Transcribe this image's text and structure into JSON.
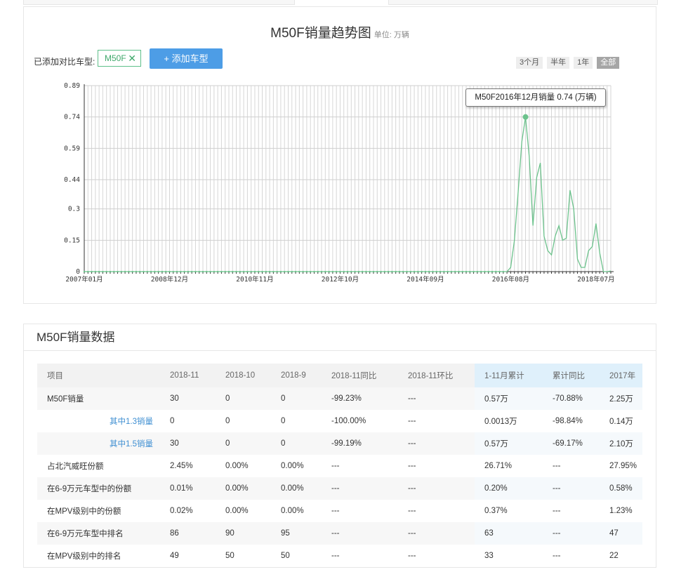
{
  "chart_section": {
    "title": "M50F销量趋势图",
    "unit": "单位: 万辆",
    "compare_label": "已添加对比车型:",
    "model_tag": "M50F",
    "remove_icon": "✕",
    "add_button": "+ 添加车型",
    "range_buttons": [
      "3个月",
      "半年",
      "1年",
      "全部"
    ],
    "active_range": "全部",
    "tooltip": "M50F2016年12月销量 0.74 (万辆)"
  },
  "chart_data": {
    "type": "line",
    "title": "M50F销量趋势图",
    "unit": "单位: 万辆",
    "ylim": [
      0,
      0.89
    ],
    "y_ticks": [
      "0",
      "0.15",
      "0.3",
      "0.44",
      "0.59",
      "0.74",
      "0.89"
    ],
    "x_ticks": [
      "2007年01月",
      "2008年12月",
      "2010年11月",
      "2012年10月",
      "2014年09月",
      "2016年08月",
      "2018年07月"
    ],
    "x_range": [
      "2007-01",
      "2018-11"
    ],
    "grid": "vertical monthly lines and horizontal lines at y ticks",
    "series": [
      {
        "name": "M50F",
        "color": "#6cc28c",
        "x": [
          "2016-07",
          "2016-08",
          "2016-09",
          "2016-10",
          "2016-11",
          "2016-12",
          "2017-01",
          "2017-02",
          "2017-03",
          "2017-04",
          "2017-05",
          "2017-06",
          "2017-07",
          "2017-08",
          "2017-09",
          "2017-10",
          "2017-11",
          "2017-12",
          "2018-01",
          "2018-02",
          "2018-03",
          "2018-04",
          "2018-05",
          "2018-06",
          "2018-07",
          "2018-08",
          "2018-09",
          "2018-10",
          "2018-11"
        ],
        "values": [
          0,
          0.02,
          0.15,
          0.38,
          0.62,
          0.74,
          0.55,
          0.22,
          0.45,
          0.52,
          0.17,
          0.1,
          0.08,
          0.17,
          0.22,
          0.15,
          0.16,
          0.39,
          0.3,
          0.06,
          0.02,
          0.02,
          0.1,
          0.12,
          0.23,
          0.09,
          0,
          0,
          0.003
        ],
        "highlight": {
          "x": "2016-12",
          "value": 0.74
        }
      }
    ]
  },
  "data_section": {
    "title": "M50F销量数据",
    "headers": [
      "项目",
      "2018-11",
      "2018-10",
      "2018-9",
      "2018-11同比",
      "2018-11环比",
      "1-11月累计",
      "累计同比",
      "2017年"
    ],
    "rows": [
      {
        "label": "M50F销量",
        "cells": [
          "30",
          "0",
          "0",
          "-99.23%",
          "---",
          "0.57万",
          "-70.88%",
          "2.25万"
        ]
      },
      {
        "label": "其中1.3销量",
        "cells": [
          "0",
          "0",
          "0",
          "-100.00%",
          "---",
          "0.0013万",
          "-98.84%",
          "0.14万"
        ]
      },
      {
        "label": "其中1.5销量",
        "cells": [
          "30",
          "0",
          "0",
          "-99.19%",
          "---",
          "0.57万",
          "-69.17%",
          "2.10万"
        ]
      },
      {
        "label": "占北汽威旺份额",
        "cells": [
          "2.45%",
          "0.00%",
          "0.00%",
          "---",
          "---",
          "26.71%",
          "---",
          "27.95%"
        ]
      },
      {
        "label": "在6-9万元车型中的份额",
        "cells": [
          "0.01%",
          "0.00%",
          "0.00%",
          "---",
          "---",
          "0.20%",
          "---",
          "0.58%"
        ]
      },
      {
        "label": "在MPV级别中的份额",
        "cells": [
          "0.02%",
          "0.00%",
          "0.00%",
          "---",
          "---",
          "0.37%",
          "---",
          "1.23%"
        ]
      },
      {
        "label": "在6-9万元车型中排名",
        "cells": [
          "86",
          "90",
          "95",
          "---",
          "---",
          "63",
          "---",
          "47"
        ]
      },
      {
        "label": "在MPV级别中的排名",
        "cells": [
          "49",
          "50",
          "50",
          "---",
          "---",
          "33",
          "---",
          "22"
        ]
      }
    ]
  }
}
